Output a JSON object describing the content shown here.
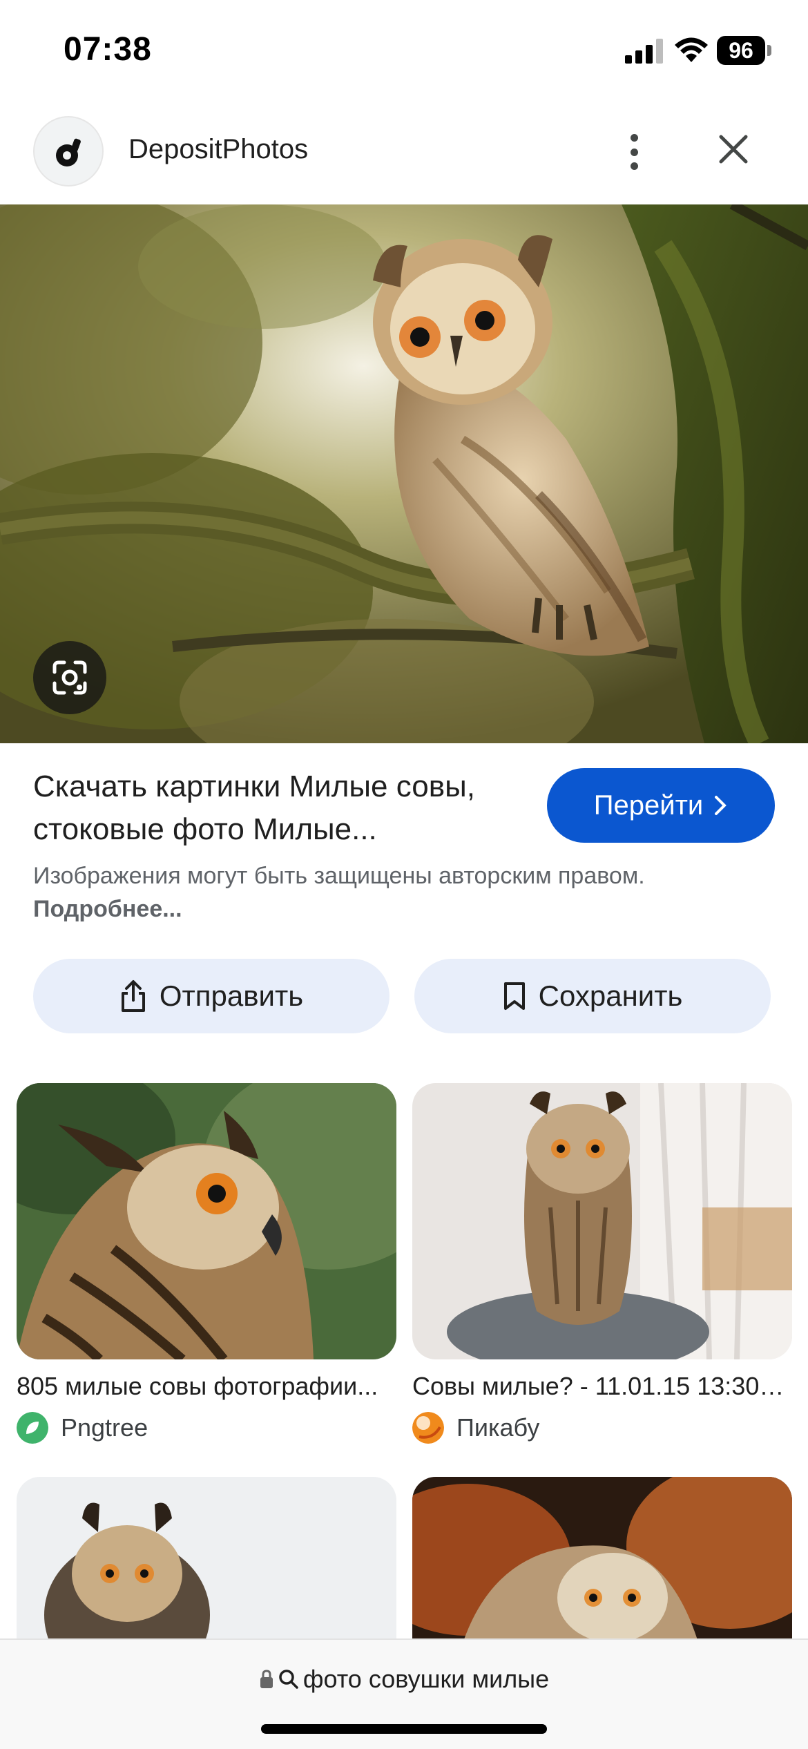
{
  "status_bar": {
    "time": "07:38",
    "battery": "96"
  },
  "header": {
    "site_name": "DepositPhotos",
    "logo_icon": "depositphotos-logo-icon",
    "more_icon": "more-vert-icon",
    "close_icon": "close-icon"
  },
  "result": {
    "title": "Скачать картинки Милые совы, стоковые фото Милые...",
    "visit_label": "Перейти",
    "copyright_text": "Изображения могут быть защищены авторским правом.",
    "more_link": "Подробнее...",
    "share_label": "Отправить",
    "save_label": "Сохранить"
  },
  "related": [
    {
      "caption": "805 милые совы фотографии...",
      "source": "Pngtree",
      "source_color": "#3fb36b"
    },
    {
      "caption": "Совы милые? - 11.01.15 13:30 | ...",
      "source": "Пикабу",
      "source_color": "#f08a1c"
    },
    {
      "caption": "",
      "source": ""
    },
    {
      "caption": "",
      "source": ""
    }
  ],
  "bottom_bar": {
    "url": "фото совушки милые"
  },
  "colors": {
    "accent": "#0b57d0",
    "chip_bg": "#e8eefa"
  }
}
